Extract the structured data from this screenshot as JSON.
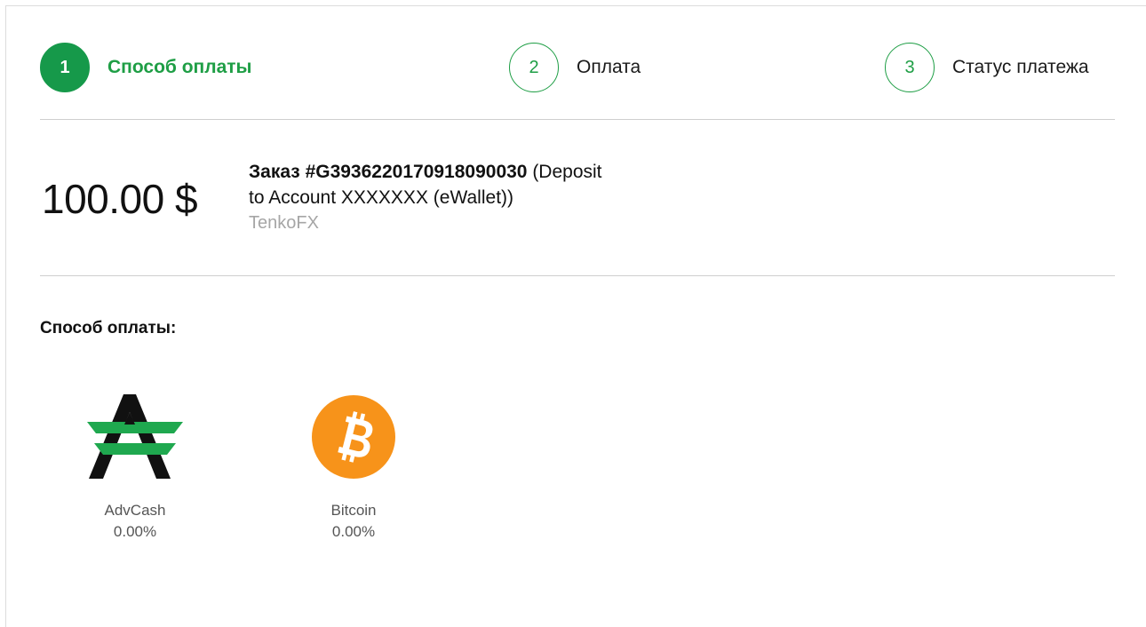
{
  "steps": [
    {
      "number": "1",
      "label": "Способ оплаты"
    },
    {
      "number": "2",
      "label": "Оплата"
    },
    {
      "number": "3",
      "label": "Статус платежа"
    }
  ],
  "active_step": 1,
  "order": {
    "amount": "100.00 $",
    "prefix": "Заказ ",
    "id": "#G3936220170918090030",
    "description_line1": " (Deposit",
    "description_line2": "to Account XXXXXXX (eWallet))",
    "merchant": "TenkoFX"
  },
  "payment_methods": {
    "title": "Способ оплаты:",
    "items": [
      {
        "name": "AdvCash",
        "fee": "0.00%",
        "icon": "advcash-logo-icon"
      },
      {
        "name": "Bitcoin",
        "fee": "0.00%",
        "icon": "bitcoin-logo-icon"
      }
    ]
  },
  "colors": {
    "accent_green": "#16994a",
    "bitcoin_orange": "#f7931a",
    "advcash_green": "#1fa84f",
    "muted_text": "#a6a6a6"
  }
}
